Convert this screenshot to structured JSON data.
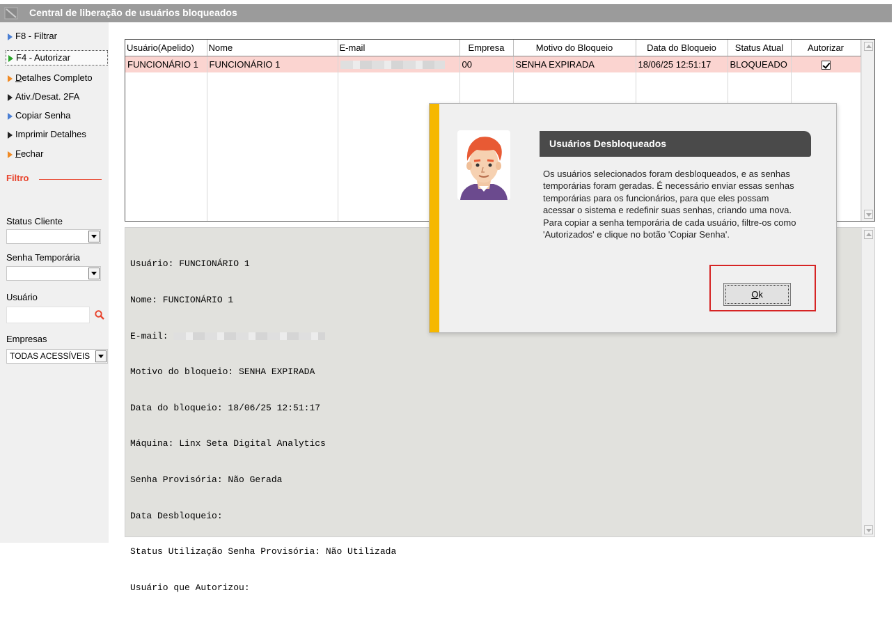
{
  "window": {
    "title": "Central de liberação de usuários bloqueados"
  },
  "sidebar": {
    "items": [
      {
        "label": "F8 - Filtrar",
        "arrow_color": "#4a7fd4"
      },
      {
        "label": "F4 - Autorizar",
        "arrow_color": "#2aa52a"
      },
      {
        "label_prefix": "D",
        "label_rest": "etalhes Completo",
        "arrow_color": "#f08a24"
      },
      {
        "label": "Ativ./Desat. 2FA",
        "arrow_color": "#222222"
      },
      {
        "label": "Copiar Senha",
        "arrow_color": "#4a7fd4"
      },
      {
        "label": "Imprimir Detalhes",
        "arrow_color": "#222222"
      },
      {
        "label_prefix": "F",
        "label_rest": "echar",
        "arrow_color": "#f08a24"
      }
    ],
    "filter_heading": "Filtro",
    "fields": {
      "status_cliente": {
        "label": "Status Cliente",
        "value": ""
      },
      "senha_temporaria": {
        "label": "Senha Temporária",
        "value": ""
      },
      "usuario": {
        "label": "Usuário",
        "value": ""
      },
      "empresas": {
        "label": "Empresas",
        "value": "TODAS ACESSÍVEIS"
      }
    }
  },
  "grid": {
    "columns": [
      "Usuário(Apelido)",
      "Nome",
      "E-mail",
      "Empresa",
      "Motivo do Bloqueio",
      "Data do Bloqueio",
      "Status Atual",
      "Autorizar"
    ],
    "rows": [
      {
        "apelido": "FUNCIONÁRIO 1",
        "nome": "FUNCIONÁRIO 1",
        "email": "",
        "empresa": "00",
        "motivo": "SENHA EXPIRADA",
        "data": "18/06/25 12:51:17",
        "status": "BLOQUEADO",
        "autorizar": true
      }
    ],
    "row_color": "#fbd4d0"
  },
  "details": {
    "lines": [
      "Usuário: FUNCIONÁRIO 1",
      "Nome: FUNCIONÁRIO 1",
      "E-mail: ",
      "Motivo do bloqueio: SENHA EXPIRADA",
      "Data do bloqueio: 18/06/25 12:51:17",
      "Máquina: Linx Seta Digital Analytics",
      "Senha Provisória: Não Gerada",
      "Data Desbloqueio:",
      "Status Utilização Senha Provisória: Não Utilizada",
      "Usuário que Autorizou:"
    ]
  },
  "dialog": {
    "title": "Usuários Desbloqueados",
    "message": "Os usuários selecionados foram desbloqueados, e as senhas temporárias foram geradas. É necessário enviar essas senhas temporárias para os funcionários, para que eles possam acessar o sistema e redefinir suas senhas, criando uma nova. Para copiar a senha temporária de cada usuário, filtre-os como 'Autorizados' e clique no botão 'Copiar Senha'.",
    "ok_label_mnemonic": "O",
    "ok_label_rest": "k",
    "accent_color": "#f6b800",
    "highlight_color": "#d62424"
  }
}
